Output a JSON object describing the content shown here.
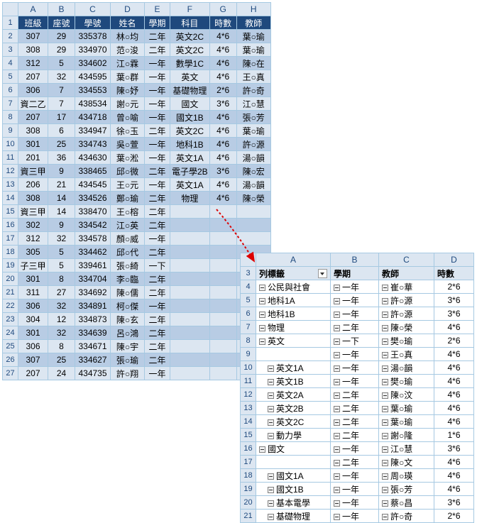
{
  "sheet1": {
    "cols": [
      "A",
      "B",
      "C",
      "D",
      "E",
      "F",
      "G",
      "H"
    ],
    "headers": [
      "班級",
      "座號",
      "學號",
      "姓名",
      "學期",
      "科目",
      "時數",
      "教師"
    ],
    "rows": [
      [
        "307",
        "29",
        "335378",
        "林○均",
        "二年",
        "英文2C",
        "4*6",
        "葉○瑜"
      ],
      [
        "308",
        "29",
        "334970",
        "范○浚",
        "二年",
        "英文2C",
        "4*6",
        "葉○瑜"
      ],
      [
        "312",
        "5",
        "334602",
        "江○霖",
        "一年",
        "數學1C",
        "4*6",
        "陳○在"
      ],
      [
        "207",
        "32",
        "434595",
        "葉○群",
        "一年",
        "英文",
        "4*6",
        "王○真"
      ],
      [
        "306",
        "7",
        "334553",
        "陳○妤",
        "一年",
        "基礎物理",
        "2*6",
        "許○奇"
      ],
      [
        "資二乙",
        "7",
        "438534",
        "謝○元",
        "一年",
        "國文",
        "3*6",
        "江○慧"
      ],
      [
        "207",
        "17",
        "434718",
        "曾○喻",
        "一年",
        "國文1B",
        "4*6",
        "張○芳"
      ],
      [
        "308",
        "6",
        "334947",
        "徐○玉",
        "二年",
        "英文2C",
        "4*6",
        "葉○瑜"
      ],
      [
        "301",
        "25",
        "334743",
        "吳○萱",
        "一年",
        "地科1B",
        "4*6",
        "許○源"
      ],
      [
        "201",
        "36",
        "434630",
        "葉○淞",
        "一年",
        "英文1A",
        "4*6",
        "湯○韻"
      ],
      [
        "資三甲",
        "9",
        "338465",
        "邱○微",
        "二年",
        "電子學2B",
        "3*6",
        "陳○宏"
      ],
      [
        "206",
        "21",
        "434545",
        "王○元",
        "一年",
        "英文1A",
        "4*6",
        "湯○韻"
      ],
      [
        "308",
        "14",
        "334526",
        "鄭○瑜",
        "二年",
        "物理",
        "4*6",
        "陳○榮"
      ],
      [
        "資三甲",
        "14",
        "338470",
        "王○榕",
        "二年",
        "",
        "",
        ""
      ],
      [
        "302",
        "9",
        "334542",
        "江○英",
        "二年",
        "",
        "",
        ""
      ],
      [
        "312",
        "32",
        "334578",
        "顏○威",
        "一年",
        "",
        "",
        ""
      ],
      [
        "305",
        "5",
        "334462",
        "邱○代",
        "二年",
        "",
        "",
        ""
      ],
      [
        "子三甲",
        "5",
        "339461",
        "張○綺",
        "一下",
        "",
        "",
        ""
      ],
      [
        "301",
        "8",
        "334704",
        "李○臨",
        "二年",
        "",
        "",
        ""
      ],
      [
        "311",
        "27",
        "334692",
        "陳○儒",
        "二年",
        "",
        "",
        ""
      ],
      [
        "306",
        "32",
        "334891",
        "柯○傑",
        "一年",
        "",
        "",
        ""
      ],
      [
        "304",
        "12",
        "334873",
        "陳○玄",
        "二年",
        "",
        "",
        ""
      ],
      [
        "301",
        "32",
        "334639",
        "呂○鴻",
        "二年",
        "",
        "",
        ""
      ],
      [
        "306",
        "8",
        "334671",
        "陳○宇",
        "二年",
        "",
        "",
        ""
      ],
      [
        "307",
        "25",
        "334627",
        "張○瑜",
        "二年",
        "",
        "",
        ""
      ],
      [
        "207",
        "24",
        "434735",
        "許○翔",
        "一年",
        "",
        "",
        ""
      ]
    ]
  },
  "sheet2": {
    "cols": [
      "A",
      "B",
      "C",
      "D"
    ],
    "phdr": [
      "列標籤",
      "學期",
      "教師",
      "時數"
    ],
    "rows": [
      {
        "r": 4,
        "a": "公民與社會",
        "b": "一年",
        "c": "崔○華",
        "d": "2*6",
        "i": 0
      },
      {
        "r": 5,
        "a": "地科1A",
        "b": "一年",
        "c": "許○源",
        "d": "3*6",
        "i": 0
      },
      {
        "r": 6,
        "a": "地科1B",
        "b": "一年",
        "c": "許○源",
        "d": "3*6",
        "i": 0
      },
      {
        "r": 7,
        "a": "物理",
        "b": "二年",
        "c": "陳○榮",
        "d": "4*6",
        "i": 0
      },
      {
        "r": 8,
        "a": "英文",
        "b": "一下",
        "c": "樊○瑜",
        "d": "2*6",
        "i": 0
      },
      {
        "r": 9,
        "a": "",
        "b": "一年",
        "c": "王○真",
        "d": "4*6",
        "i": 0
      },
      {
        "r": 10,
        "a": "英文1A",
        "b": "一年",
        "c": "湯○韻",
        "d": "4*6",
        "i": 1
      },
      {
        "r": 11,
        "a": "英文1B",
        "b": "一年",
        "c": "樊○瑜",
        "d": "4*6",
        "i": 1
      },
      {
        "r": 12,
        "a": "英文2A",
        "b": "二年",
        "c": "陳○汶",
        "d": "4*6",
        "i": 1
      },
      {
        "r": 13,
        "a": "英文2B",
        "b": "二年",
        "c": "葉○瑜",
        "d": "4*6",
        "i": 1
      },
      {
        "r": 14,
        "a": "英文2C",
        "b": "二年",
        "c": "葉○瑜",
        "d": "4*6",
        "i": 1
      },
      {
        "r": 15,
        "a": "動力學",
        "b": "二年",
        "c": "謝○隆",
        "d": "1*6",
        "i": 1
      },
      {
        "r": 16,
        "a": "國文",
        "b": "一年",
        "c": "江○慧",
        "d": "3*6",
        "i": 0
      },
      {
        "r": 17,
        "a": "",
        "b": "二年",
        "c": "陳○文",
        "d": "4*6",
        "i": 0
      },
      {
        "r": 18,
        "a": "國文1A",
        "b": "一年",
        "c": "周○瑛",
        "d": "4*6",
        "i": 1
      },
      {
        "r": 19,
        "a": "國文1B",
        "b": "一年",
        "c": "張○芳",
        "d": "4*6",
        "i": 1
      },
      {
        "r": 20,
        "a": "基本電學",
        "b": "一年",
        "c": "蔡○昌",
        "d": "3*6",
        "i": 1
      },
      {
        "r": 21,
        "a": "基礎物理",
        "b": "一年",
        "c": "許○奇",
        "d": "2*6",
        "i": 1
      }
    ]
  }
}
